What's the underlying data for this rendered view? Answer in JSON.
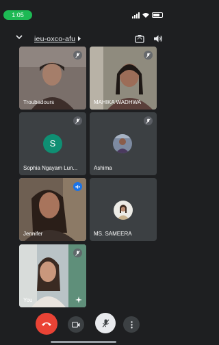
{
  "status_bar": {
    "time": "1:05"
  },
  "meeting": {
    "code": "ieu-oxco-afu"
  },
  "participants": [
    {
      "name": "Troubadours",
      "state": "muted"
    },
    {
      "name": "MAHIKA WADHWA",
      "state": "muted"
    },
    {
      "name": "Sophia Ngayam Lun...",
      "state": "muted",
      "avatar_letter": "S"
    },
    {
      "name": "Ashima",
      "state": "muted"
    },
    {
      "name": "Jennifer",
      "state": "speaking"
    },
    {
      "name": "MS. SAMEERA",
      "state": "unmuted"
    },
    {
      "name": "You",
      "state": "muted"
    }
  ],
  "colors": {
    "background": "#1e1f21",
    "tile": "#3c4043",
    "speaking_border": "#8ab4f8",
    "end_call": "#ea4335",
    "avatar_teal": "#0f8f73"
  },
  "controls": [
    "end-call",
    "camera",
    "microphone-muted",
    "more-options"
  ]
}
